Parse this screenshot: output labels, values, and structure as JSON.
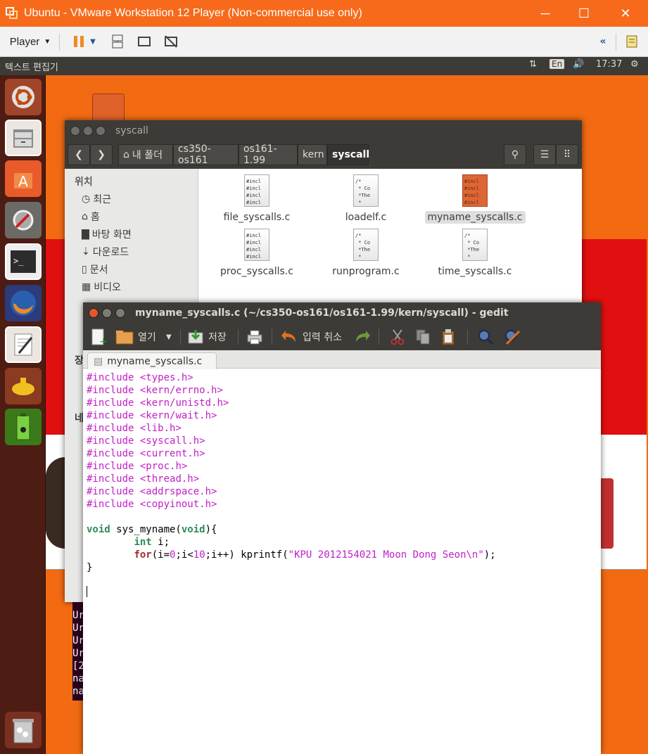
{
  "window": {
    "title": "Ubuntu - VMware Workstation 12 Player (Non-commercial use only)",
    "minimize": "─",
    "maximize": "☐",
    "close": "✕"
  },
  "player_bar": {
    "player_label": "Player"
  },
  "ubuntu_top": {
    "app_name": "텍스트 편집기",
    "lang": "En",
    "time": "17:37"
  },
  "nautilus": {
    "title": "syscall",
    "breadcrumbs": [
      "내 폴더",
      "cs350-os161",
      "os161-1.99",
      "kern",
      "syscall"
    ],
    "sidebar": {
      "header": "위치",
      "items": [
        "최근",
        "홈",
        "바탕 화면",
        "다운로드",
        "문서",
        "비디오"
      ],
      "partial": [
        "장",
        "네"
      ]
    },
    "files": [
      {
        "name": "file_syscalls.c",
        "preview": "#incl\n#incl\n#incl\n#incl"
      },
      {
        "name": "loadelf.c",
        "preview": "/*\n * Co\n *The\n *"
      },
      {
        "name": "myname_syscalls.c",
        "preview": "#incl\n#incl\n#incl\n#incl"
      },
      {
        "name": "proc_syscalls.c",
        "preview": "#incl\n#incl\n#incl\n#incl"
      },
      {
        "name": "runprogram.c",
        "preview": "/*\n * Co\n *The\n *"
      },
      {
        "name": "time_syscalls.c",
        "preview": "/*\n * Co\n *The\n *"
      }
    ]
  },
  "terminal": {
    "lines": [
      "Ur",
      "Ur",
      "Ur",
      "Ur",
      "[2",
      "na",
      "na",
      "na"
    ]
  },
  "gedit": {
    "title": "myname_syscalls.c (~/cs350-os161/os161-1.99/kern/syscall) - gedit",
    "toolbar": {
      "open": "열기",
      "save": "저장",
      "undo": "입력 취소"
    },
    "tab": "myname_syscalls.c",
    "code": {
      "includes": [
        "<types.h>",
        "<kern/errno.h>",
        "<kern/unistd.h>",
        "<kern/wait.h>",
        "<lib.h>",
        "<syscall.h>",
        "<current.h>",
        "<proc.h>",
        "<thread.h>",
        "<addrspace.h>",
        "<copyinout.h>"
      ],
      "include_kw": "#include",
      "fn_void": "void",
      "fn_sig": " sys_myname(",
      "fn_param": "void",
      "fn_open": "){",
      "int_kw": "int",
      "int_rest": " i;",
      "for_kw": "for",
      "for_a": "(i=",
      "for_n0": "0",
      "for_b": ";i<",
      "for_n10": "10",
      "for_c": ";i++) kprintf(",
      "for_str": "\"KPU 2012154021 Moon Dong Seon\\n\"",
      "for_end": ");",
      "close": "}"
    }
  }
}
